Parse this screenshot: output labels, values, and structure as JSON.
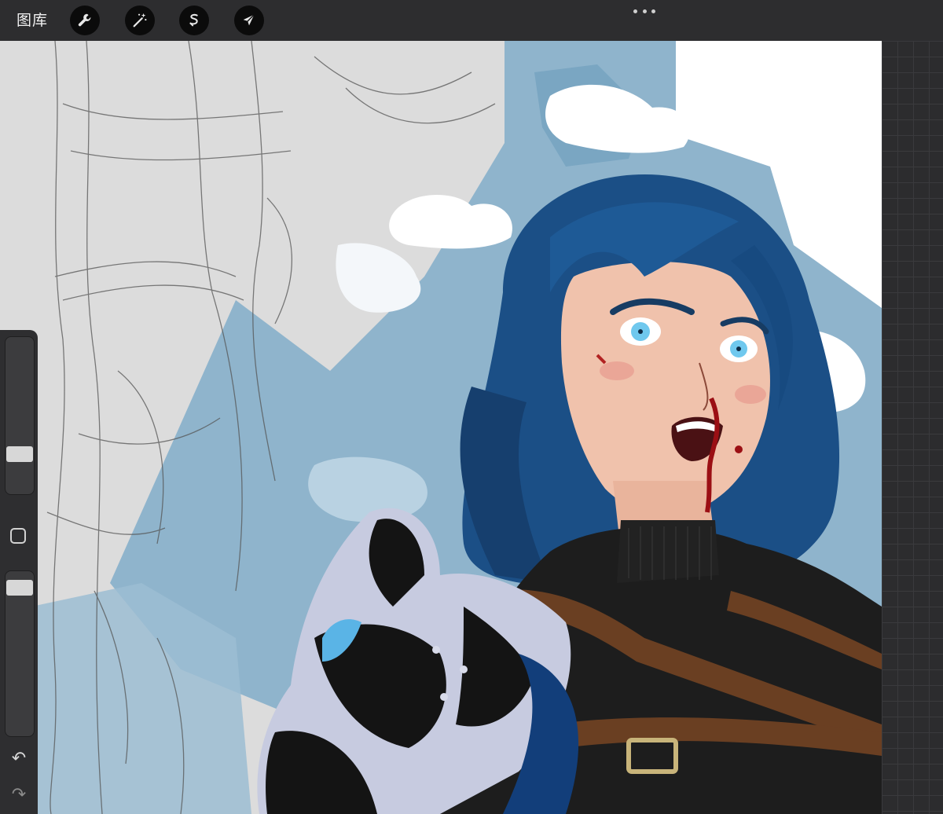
{
  "toolbar": {
    "gallery_label": "图库",
    "tools": [
      {
        "icon": "wrench-icon",
        "name": "actions"
      },
      {
        "icon": "magic-wand-icon",
        "name": "adjustments"
      },
      {
        "icon": "selection-icon",
        "name": "selection"
      },
      {
        "icon": "arrow-cursor-icon",
        "name": "transform"
      }
    ],
    "more_icon": "ellipsis-icon"
  },
  "sidebar": {
    "brush_size_level": 0.22,
    "opacity_level": 0.06,
    "modify_icon": "square-icon",
    "undo_glyph": "↶",
    "redo_glyph": "↷"
  },
  "colors": {
    "toolbar_bg": "#2d2d2f",
    "sky_blue": "#8fb4cc",
    "hair": "#1b4f86",
    "skin": "#f0c2ac"
  }
}
